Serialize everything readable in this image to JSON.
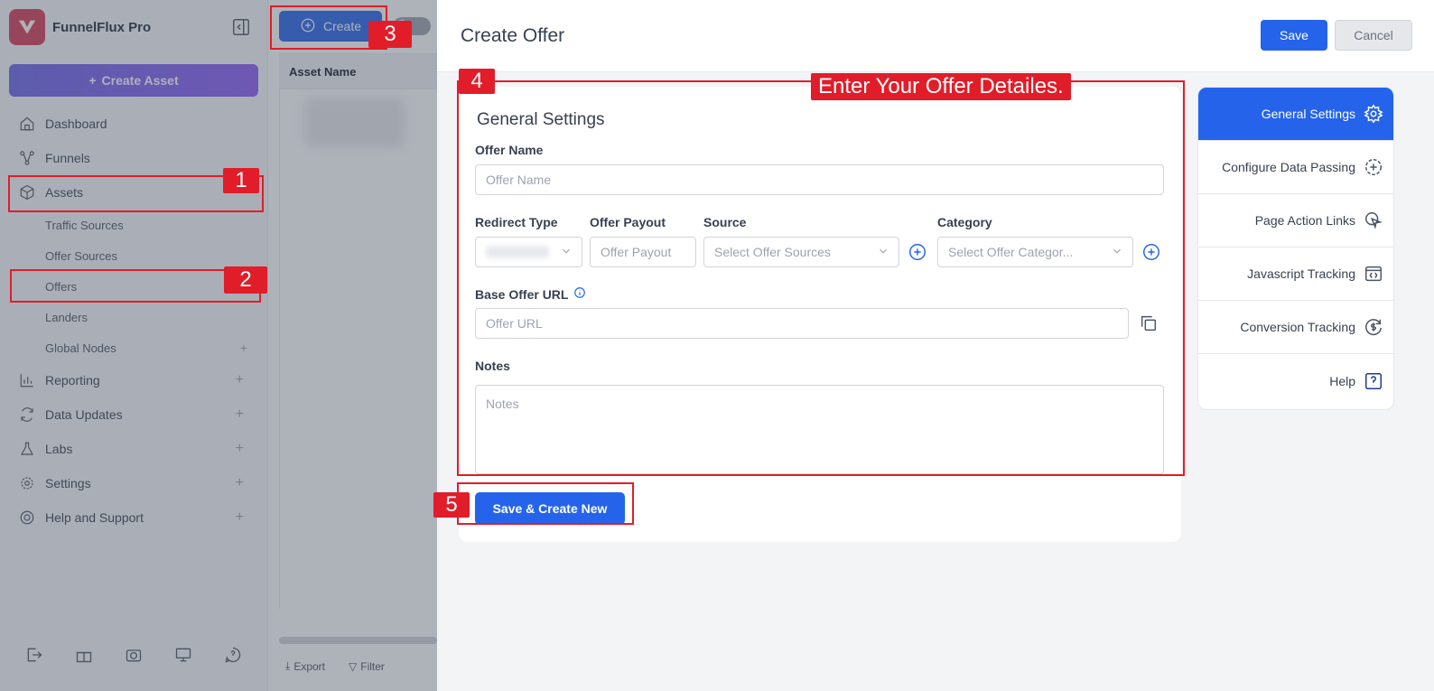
{
  "app": {
    "name": "FunnelFlux Pro"
  },
  "sidebar": {
    "create_asset_label": "Create Asset",
    "items": [
      {
        "label": "Dashboard"
      },
      {
        "label": "Funnels"
      },
      {
        "label": "Assets"
      },
      {
        "label": "Reporting"
      },
      {
        "label": "Data Updates"
      },
      {
        "label": "Labs"
      },
      {
        "label": "Settings"
      },
      {
        "label": "Help and Support"
      }
    ],
    "subitems": [
      {
        "label": "Traffic Sources"
      },
      {
        "label": "Offer Sources"
      },
      {
        "label": "Offers"
      },
      {
        "label": "Landers"
      },
      {
        "label": "Global Nodes"
      }
    ]
  },
  "list": {
    "create_label": "Create",
    "column_asset_name": "Asset Name",
    "export_label": "Export",
    "filter_label": "Filter"
  },
  "panel": {
    "title": "Create Offer",
    "save_label": "Save",
    "cancel_label": "Cancel",
    "section_title": "General Settings",
    "offer_name_label": "Offer Name",
    "offer_name_placeholder": "Offer Name",
    "redirect_type_label": "Redirect Type",
    "offer_payout_label": "Offer Payout",
    "offer_payout_placeholder": "Offer Payout",
    "source_label": "Source",
    "source_placeholder": "Select Offer Sources",
    "category_label": "Category",
    "category_placeholder": "Select Offer Categor...",
    "base_url_label": "Base Offer URL",
    "base_url_placeholder": "Offer URL",
    "notes_label": "Notes",
    "notes_placeholder": "Notes",
    "save_create_new_label": "Save & Create New"
  },
  "side_menu": {
    "items": [
      {
        "label": "General Settings",
        "icon": "gear-icon"
      },
      {
        "label": "Configure Data Passing",
        "icon": "dashed-plus-icon"
      },
      {
        "label": "Page Action Links",
        "icon": "pointer-icon"
      },
      {
        "label": "Javascript Tracking",
        "icon": "code-icon"
      },
      {
        "label": "Conversion Tracking",
        "icon": "dollar-refresh-icon"
      },
      {
        "label": "Help",
        "icon": "question-icon"
      }
    ]
  },
  "annotations": {
    "n1": "1",
    "n2": "2",
    "n3": "3",
    "n4": "4",
    "n5": "5",
    "caption": "Enter Your Offer Detailes."
  },
  "colors": {
    "accent": "#2563eb",
    "annotation": "#e11d2a",
    "brand": "#d63a52"
  }
}
